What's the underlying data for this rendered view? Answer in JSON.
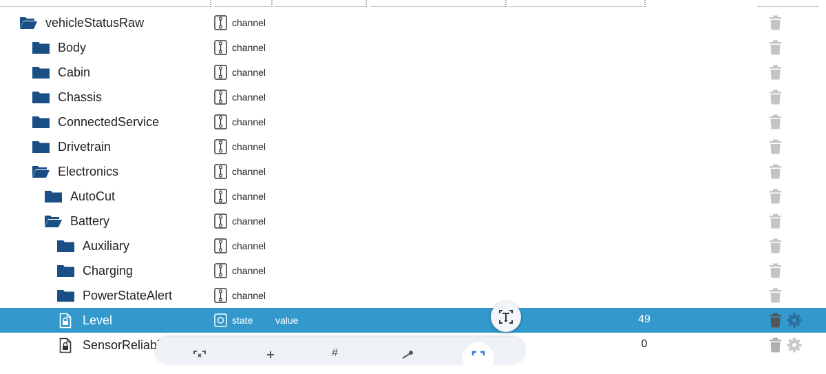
{
  "colors": {
    "folder": "#1a4f85",
    "selection": "#3399cc",
    "trash": "#c4c4c4"
  },
  "rows": [
    {
      "name": "vehicleStatusRaw",
      "icon": "folder-open-icon",
      "type": "channel",
      "role": "",
      "value": ""
    },
    {
      "name": "Body",
      "icon": "folder-icon",
      "type": "channel",
      "role": "",
      "value": ""
    },
    {
      "name": "Cabin",
      "icon": "folder-icon",
      "type": "channel",
      "role": "",
      "value": ""
    },
    {
      "name": "Chassis",
      "icon": "folder-icon",
      "type": "channel",
      "role": "",
      "value": ""
    },
    {
      "name": "ConnectedService",
      "icon": "folder-icon",
      "type": "channel",
      "role": "",
      "value": ""
    },
    {
      "name": "Drivetrain",
      "icon": "folder-icon",
      "type": "channel",
      "role": "",
      "value": ""
    },
    {
      "name": "Electronics",
      "icon": "folder-open-icon",
      "type": "channel",
      "role": "",
      "value": ""
    },
    {
      "name": "AutoCut",
      "icon": "folder-icon",
      "type": "channel",
      "role": "",
      "value": ""
    },
    {
      "name": "Battery",
      "icon": "folder-open-icon",
      "type": "channel",
      "role": "",
      "value": ""
    },
    {
      "name": "Auxiliary",
      "icon": "folder-icon",
      "type": "channel",
      "role": "",
      "value": ""
    },
    {
      "name": "Charging",
      "icon": "folder-icon",
      "type": "channel",
      "role": "",
      "value": ""
    },
    {
      "name": "PowerStateAlert",
      "icon": "folder-icon",
      "type": "channel",
      "role": "",
      "value": ""
    },
    {
      "name": "Level",
      "icon": "locked-file-icon",
      "type": "state",
      "role": "value",
      "value": "49",
      "selected": true
    },
    {
      "name": "SensorReliabil",
      "icon": "locked-file-icon",
      "type": "",
      "role": "",
      "value": "0"
    }
  ]
}
